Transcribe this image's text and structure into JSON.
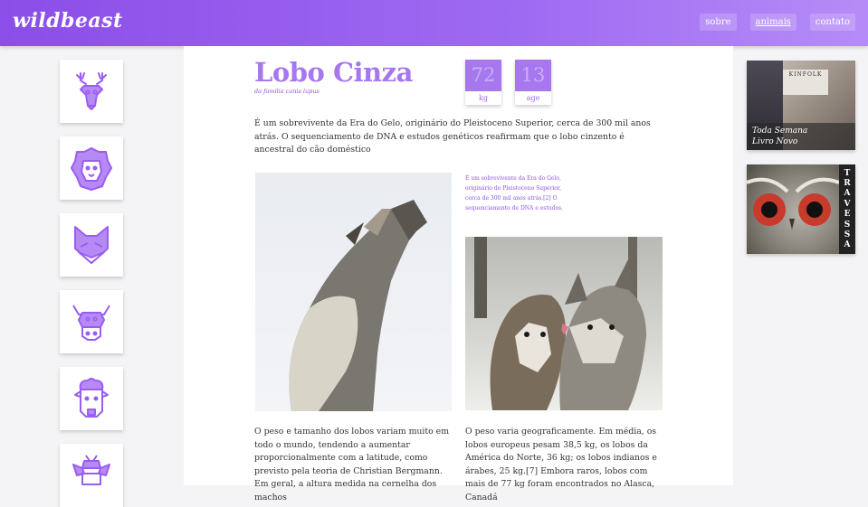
{
  "header": {
    "logo": "wildbeast",
    "nav": [
      {
        "label": "sobre"
      },
      {
        "label": "animais"
      },
      {
        "label": "contato"
      }
    ]
  },
  "sidebar": {
    "animals": [
      {
        "icon": "deer-icon"
      },
      {
        "icon": "lion-icon"
      },
      {
        "icon": "fox-icon"
      },
      {
        "icon": "bull-icon"
      },
      {
        "icon": "sheep-icon"
      },
      {
        "icon": "bee-icon"
      }
    ]
  },
  "article": {
    "title": "Lobo Cinza",
    "subtitle": "da família canis lupus",
    "stats": [
      {
        "value": "72",
        "unit": "kg"
      },
      {
        "value": "13",
        "unit": "age"
      }
    ],
    "intro": "É um sobrevivente da Era do Gelo, originário do Pleistoceno Superior, cerca de 300 mil anos atrás. O sequenciamento de DNA e estudos genéticos reafirmam que o lobo cinzento é ancestral do cão doméstico",
    "side_note": "É um sobrevivente da Era do Gelo, originário do Pleistoceno Superior, cerca de 300 mil anos atrás.[2] O sequenciamento de DNA e estudos.",
    "col1": "O peso e tamanho dos lobos variam muito em todo o mundo, tendendo a aumentar proporcionalmente com a latitude, como previsto pela teoria de Christian Bergmann. Em geral, a altura medida na cernelha dos machos",
    "col2": "O peso varia geograficamente. Em média, os lobos europeus pesam 38,5 kg, os lobos da América do Norte, 36 kg; os lobos indianos e árabes, 25 kg.[7] Embora raros, lobos com mais de 77 kg foram encontrados no Alasca, Canadá"
  },
  "ads": [
    {
      "brand": "KINFOLK",
      "caption_line1": "Toda Semana",
      "caption_line2": "Livro Novo"
    },
    {
      "vertical_text": [
        "T",
        "R",
        "A",
        "V",
        "E",
        "S",
        "S",
        "A"
      ]
    }
  ],
  "colors": {
    "accent": "#a677ee",
    "header": "#9b62ee"
  }
}
